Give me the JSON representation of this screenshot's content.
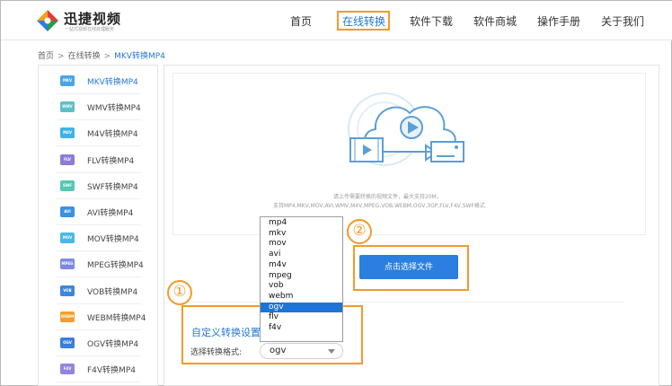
{
  "logo": {
    "title": "迅捷视频",
    "subtitle": "一站式视频在线处理服务"
  },
  "nav": {
    "items": [
      {
        "label": "首页"
      },
      {
        "label": "在线转换"
      },
      {
        "label": "软件下载"
      },
      {
        "label": "软件商城"
      },
      {
        "label": "操作手册"
      },
      {
        "label": "关于我们"
      }
    ]
  },
  "breadcrumb": {
    "home": "首页",
    "section": "在线转换",
    "current": "MKV转换MP4",
    "separator": ">"
  },
  "sidebar": {
    "items": [
      {
        "badge": "MKV",
        "label": "MKV转换MP4",
        "color": "#4aa6e6"
      },
      {
        "badge": "WMV",
        "label": "WMV转换MP4",
        "color": "#5fc0c8"
      },
      {
        "badge": "M4V",
        "label": "M4V转换MP4",
        "color": "#3fb2e8"
      },
      {
        "badge": "FLV",
        "label": "FLV转换MP4",
        "color": "#8f7bd6"
      },
      {
        "badge": "SWF",
        "label": "SWF转换MP4",
        "color": "#57c6b3"
      },
      {
        "badge": "AVI",
        "label": "AVI转换MP4",
        "color": "#3d8fe0"
      },
      {
        "badge": "MOV",
        "label": "MOV转换MP4",
        "color": "#48b8e8"
      },
      {
        "badge": "MPEG",
        "label": "MPEG转换MP4",
        "color": "#7e8ae0"
      },
      {
        "badge": "VOB",
        "label": "VOB转换MP4",
        "color": "#3c86db"
      },
      {
        "badge": "WEBM",
        "label": "WEBM转换MP4",
        "color": "#f0a02a"
      },
      {
        "badge": "OGV",
        "label": "OGV转换MP4",
        "color": "#3a7fd8"
      },
      {
        "badge": "F4V",
        "label": "F4V转换MP4",
        "color": "#9384de"
      }
    ]
  },
  "upload": {
    "hint_line1": "请上传需要转换的视频文件，最大支持20M，",
    "hint_line2": "支持MP4,MKV,MOV,AVI,WMV,M4V,MPEG,VOB,WEBM,OGV,3GP,FLV,F4V,SWF格式",
    "button_label": "点击选择文件"
  },
  "settings": {
    "title": "自定义转换设置",
    "format_label": "选择转换格式:",
    "format_value": "ogv",
    "format_options": [
      "mp4",
      "mkv",
      "mov",
      "avi",
      "m4v",
      "mpeg",
      "vob",
      "webm",
      "ogv",
      "flv",
      "f4v"
    ],
    "selected_option": "ogv"
  },
  "annotations": {
    "step1": "①",
    "step2": "②",
    "highlight_color": "#f39a2b"
  },
  "colors": {
    "accent": "#2478d4",
    "button": "#2a7fe0"
  }
}
